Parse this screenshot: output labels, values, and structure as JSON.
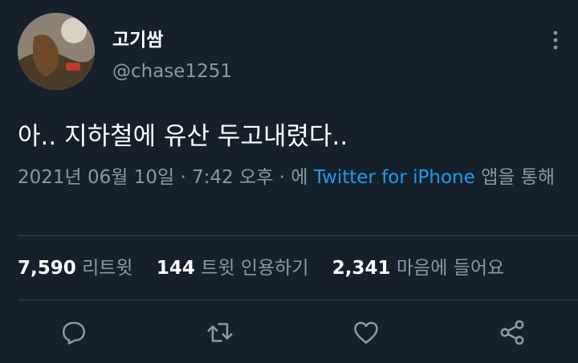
{
  "user": {
    "display_name": "고기쌈",
    "handle": "@chase1251"
  },
  "tweet": {
    "text": "아.. 지하철에 유산 두고내렸다..",
    "timestamp": "2021년 06월 10일 · 7:42 오후 · 에 ",
    "source": "Twitter for iPhone",
    "source_suffix": " 앱을 통해"
  },
  "stats": {
    "retweets": {
      "count": "7,590",
      "label": "리트윗"
    },
    "quotes": {
      "count": "144",
      "label": "트윗 인용하기"
    },
    "likes": {
      "count": "2,341",
      "label": "마음에 들어요"
    }
  },
  "icons": {
    "more": "more-vertical-icon",
    "reply": "reply-icon",
    "retweet": "retweet-icon",
    "like": "heart-icon",
    "share": "share-icon"
  },
  "colors": {
    "background": "#15202b",
    "text": "#ffffff",
    "secondary": "#8899a6",
    "link": "#1d9bf0",
    "divider": "#38444d"
  }
}
